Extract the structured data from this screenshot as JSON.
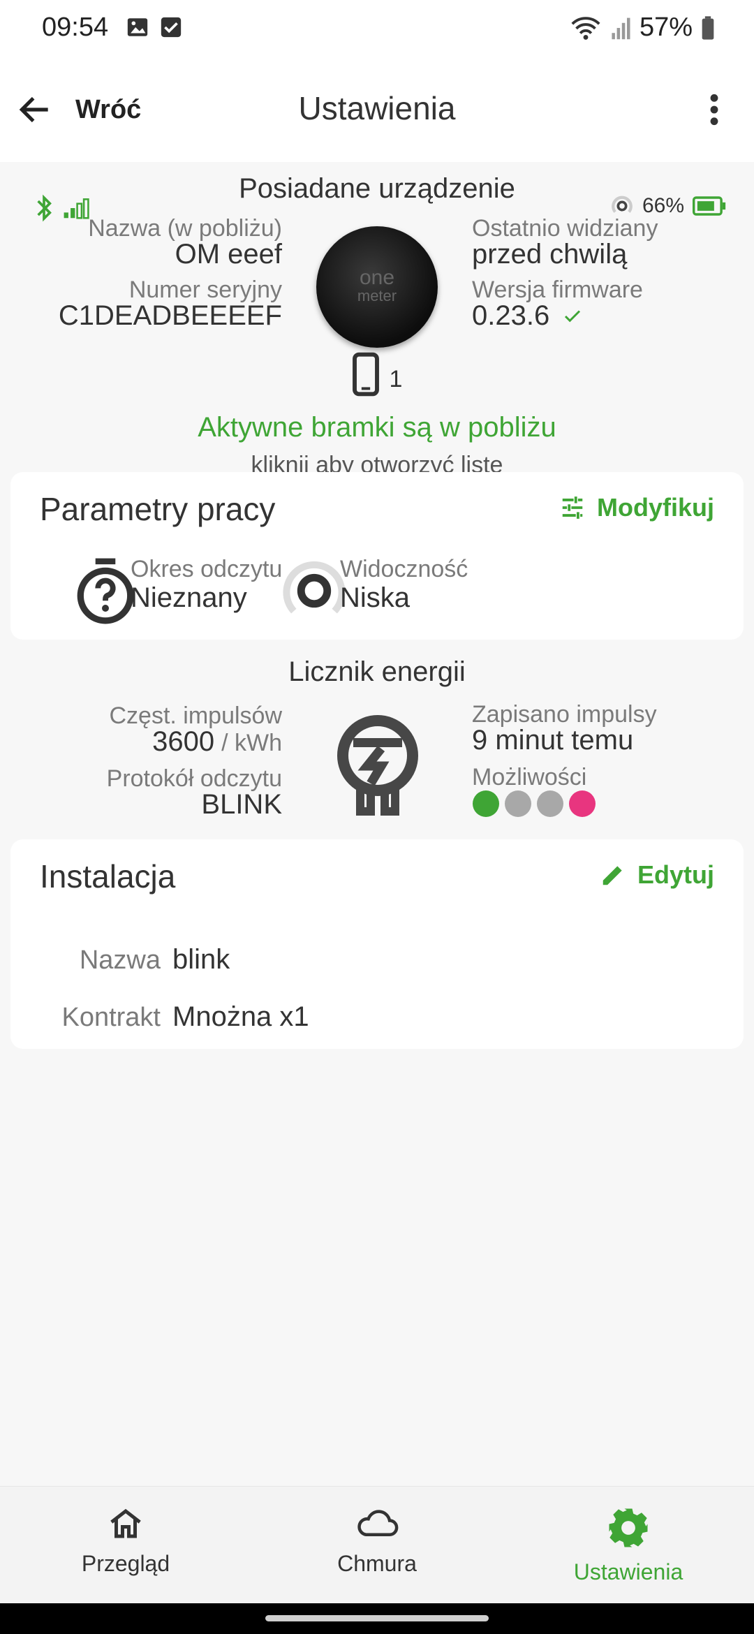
{
  "status_bar": {
    "time": "09:54",
    "battery": "57%"
  },
  "app_bar": {
    "back_label": "Wróć",
    "title": "Ustawienia"
  },
  "device_status": {
    "battery": "66%"
  },
  "device": {
    "section_title": "Posiadane urządzenie",
    "name_label": "Nazwa (w pobliżu)",
    "name_value": "OM eeef",
    "serial_label": "Numer seryjny",
    "serial_value": "C1DEADBEEEEF",
    "last_seen_label": "Ostatnio widziany",
    "last_seen_value": "przed chwilą",
    "firmware_label": "Wersja firmware",
    "firmware_value": "0.23.6",
    "logo_line1": "one",
    "logo_line2": "meter"
  },
  "gateways": {
    "count": "1",
    "title": "Aktywne bramki są w pobliżu",
    "subtitle": "kliknij aby otworzyć listę"
  },
  "work_params": {
    "title": "Parametry pracy",
    "action_label": "Modyfikuj",
    "read_period_label": "Okres odczytu",
    "read_period_value": "Nieznany",
    "visibility_label": "Widoczność",
    "visibility_value": "Niska"
  },
  "energy_meter": {
    "section_title": "Licznik energii",
    "pulse_freq_label": "Częst. impulsów",
    "pulse_freq_value": "3600",
    "pulse_freq_unit": "/ kWh",
    "protocol_label": "Protokół odczytu",
    "protocol_value": "BLINK",
    "saved_label": "Zapisano impulsy",
    "saved_value": "9 minut temu",
    "capabilities_label": "Możliwości",
    "capabilities_colors": [
      "#3fa535",
      "#a8a8a8",
      "#a8a8a8",
      "#e8357f"
    ]
  },
  "installation": {
    "title": "Instalacja",
    "action_label": "Edytuj",
    "name_label": "Nazwa",
    "name_value": "blink",
    "contract_label": "Kontrakt",
    "contract_value": "Mnożna x1"
  },
  "bottom_nav": {
    "items": [
      {
        "label": "Przegląd",
        "icon": "home-icon"
      },
      {
        "label": "Chmura",
        "icon": "cloud-icon"
      },
      {
        "label": "Ustawienia",
        "icon": "gear-icon"
      }
    ],
    "active_index": 2
  },
  "colors": {
    "accent": "#3fa535",
    "text": "#2c2c2c",
    "muted": "#7a7a7a"
  }
}
